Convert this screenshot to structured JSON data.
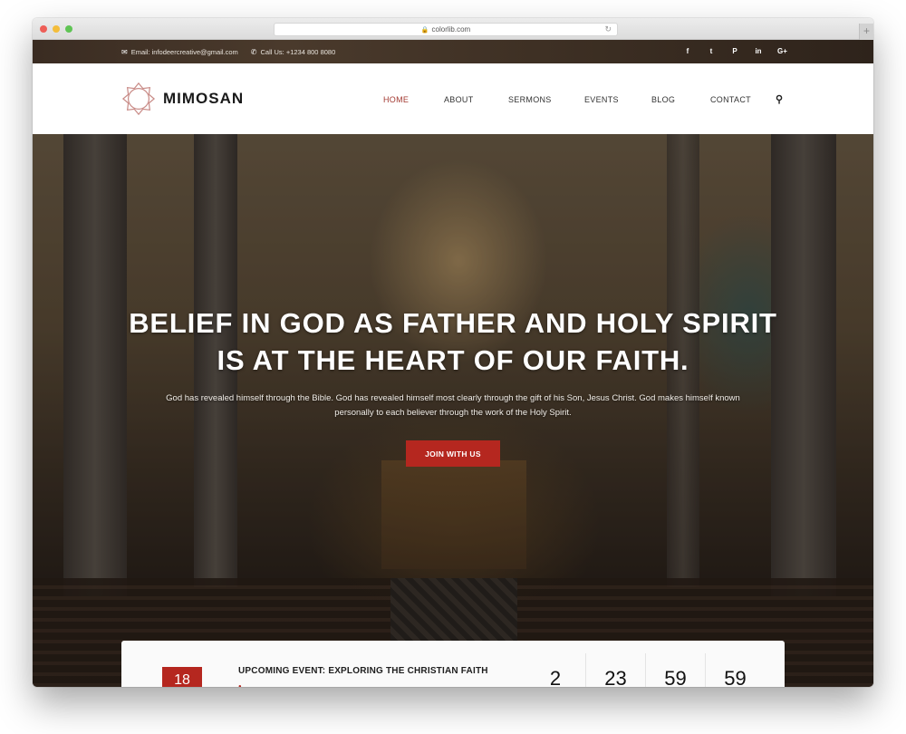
{
  "browser": {
    "url": "colorlib.com",
    "lock_icon": "lock-icon",
    "reload_icon": "reload-icon",
    "new_tab_label": "+"
  },
  "topbar": {
    "email_icon": "envelope-icon",
    "email": "Email: infodeercreative@gmail.com",
    "phone_icon": "phone-icon",
    "phone": "Call Us: +1234 800 8080",
    "social": [
      {
        "name": "facebook-icon",
        "glyph": "f"
      },
      {
        "name": "twitter-icon",
        "glyph": "t"
      },
      {
        "name": "pinterest-icon",
        "glyph": "P"
      },
      {
        "name": "linkedin-icon",
        "glyph": "in"
      },
      {
        "name": "google-plus-icon",
        "glyph": "G+"
      }
    ]
  },
  "header": {
    "logo_text": "MIMOSAN",
    "logo_color": "#c98c88",
    "nav": [
      {
        "label": "HOME",
        "active": true
      },
      {
        "label": "ABOUT",
        "active": false
      },
      {
        "label": "SERMONS",
        "active": false
      },
      {
        "label": "EVENTS",
        "active": false
      },
      {
        "label": "BLOG",
        "active": false
      },
      {
        "label": "CONTACT",
        "active": false
      }
    ],
    "search_icon": "search-icon",
    "accent_color": "#a33a32"
  },
  "hero": {
    "title_line1": "BELIEF IN GOD AS FATHER AND HOLY SPIRIT",
    "title_line2": "IS AT THE HEART OF OUR FAITH.",
    "text": "God has revealed himself through the Bible. God has revealed himself most clearly through the gift of his Son, Jesus Christ. God makes himself known personally to each believer through the work of the Holy Spirit.",
    "button_label": "JOIN WITH US",
    "button_color": "#b5271f"
  },
  "event": {
    "date_day": "18",
    "title": "UPCOMING EVENT: EXPLORING THE CHRISTIAN FAITH",
    "countdown": [
      "2",
      "23",
      "59",
      "59"
    ]
  }
}
